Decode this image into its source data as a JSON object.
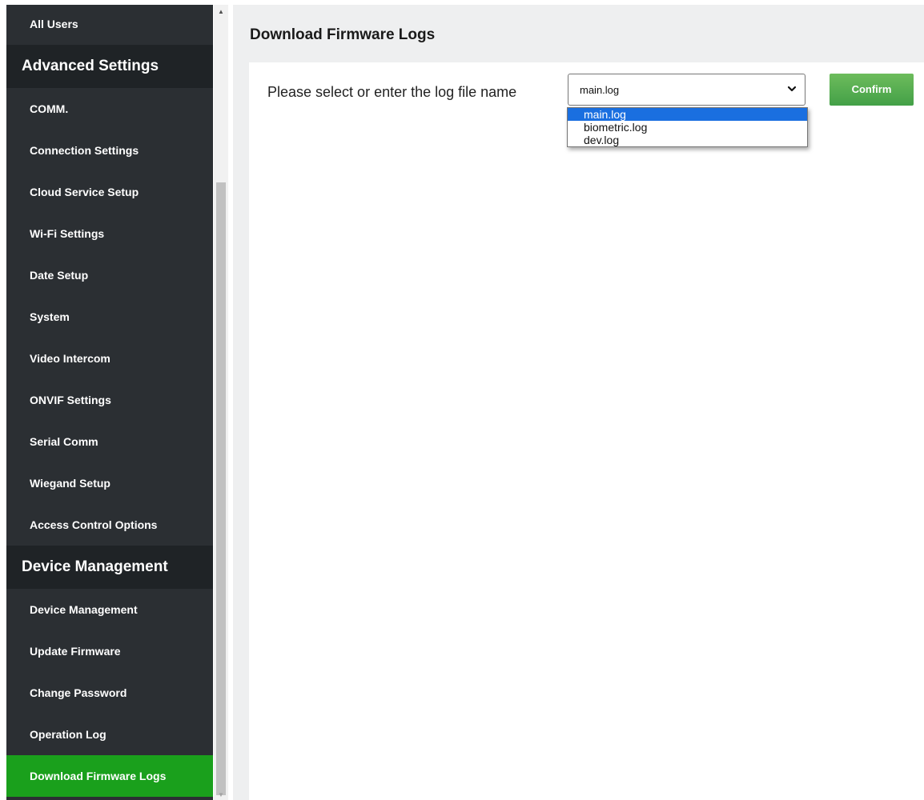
{
  "sidebar": {
    "top_item": "All Users",
    "advanced_header": "Advanced Settings",
    "advanced_items": [
      "COMM.",
      "Connection Settings",
      "Cloud Service Setup",
      "Wi-Fi Settings",
      "Date Setup",
      "System",
      "Video Intercom",
      "ONVIF Settings",
      "Serial Comm",
      "Wiegand Setup",
      "Access Control Options"
    ],
    "device_header": "Device Management",
    "device_items": [
      "Device Management",
      "Update Firmware",
      "Change Password",
      "Operation Log",
      "Download Firmware Logs"
    ],
    "active_item": "Download Firmware Logs"
  },
  "main": {
    "title": "Download Firmware Logs",
    "field_label": "Please select or enter the log file name",
    "select": {
      "value": "main.log",
      "options": [
        "main.log",
        "biometric.log",
        "dev.log"
      ],
      "highlighted": "main.log"
    },
    "confirm_label": "Confirm"
  },
  "colors": {
    "sidebar_bg": "#2b2f33",
    "sidebar_header_bg": "#1f2326",
    "active_item_bg": "#1aa01c",
    "confirm_green": "#4caf50",
    "option_highlight": "#1a6fe0",
    "main_bg": "#eeeff0"
  },
  "icons": {
    "select_arrow": "chevron-down-icon",
    "scroll_up": "scroll-up-arrow-icon",
    "scroll_down": "scroll-down-arrow-icon"
  }
}
